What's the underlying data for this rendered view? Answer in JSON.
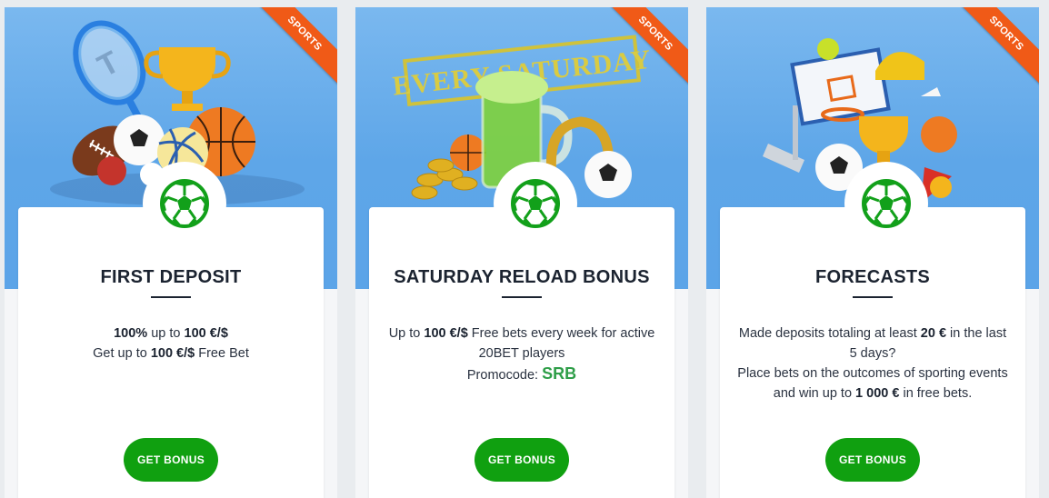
{
  "cards": [
    {
      "tag": "SPORTS",
      "title": "FIRST DEPOSIT",
      "line1_bold_a": "100%",
      "line1_mid": " up to ",
      "line1_bold_b": "100 €/$",
      "line2_pre": "Get up to ",
      "line2_bold": "100 €/$",
      "line2_post": " Free Bet",
      "button": "GET BONUS"
    },
    {
      "tag": "SPORTS",
      "banner_text": "EVERY SATURDAY",
      "title": "SATURDAY RELOAD BONUS",
      "line1_pre": "Up to ",
      "line1_bold": "100 €/$",
      "line1_post": " Free bets every week for active 20BET players",
      "promo_label": "Promocode: ",
      "promo_code": "SRB",
      "button": "GET BONUS"
    },
    {
      "tag": "SPORTS",
      "title": "FORECASTS",
      "line1_pre": "Made deposits totaling at least ",
      "line1_bold": "20 €",
      "line1_post": " in the last 5 days?",
      "line2_pre": "Place bets on the outcomes of sporting events and win up to ",
      "line2_bold": "1 000 €",
      "line2_post": " in free bets.",
      "button": "GET BONUS"
    }
  ],
  "colors": {
    "hero_blue": "#5ea6e8",
    "ribbon_orange": "#f05a17",
    "button_green": "#10a010",
    "promo_green": "#2e9e48",
    "title_dark": "#1b2330"
  },
  "icons": {
    "badge": "soccer-ball-icon"
  }
}
